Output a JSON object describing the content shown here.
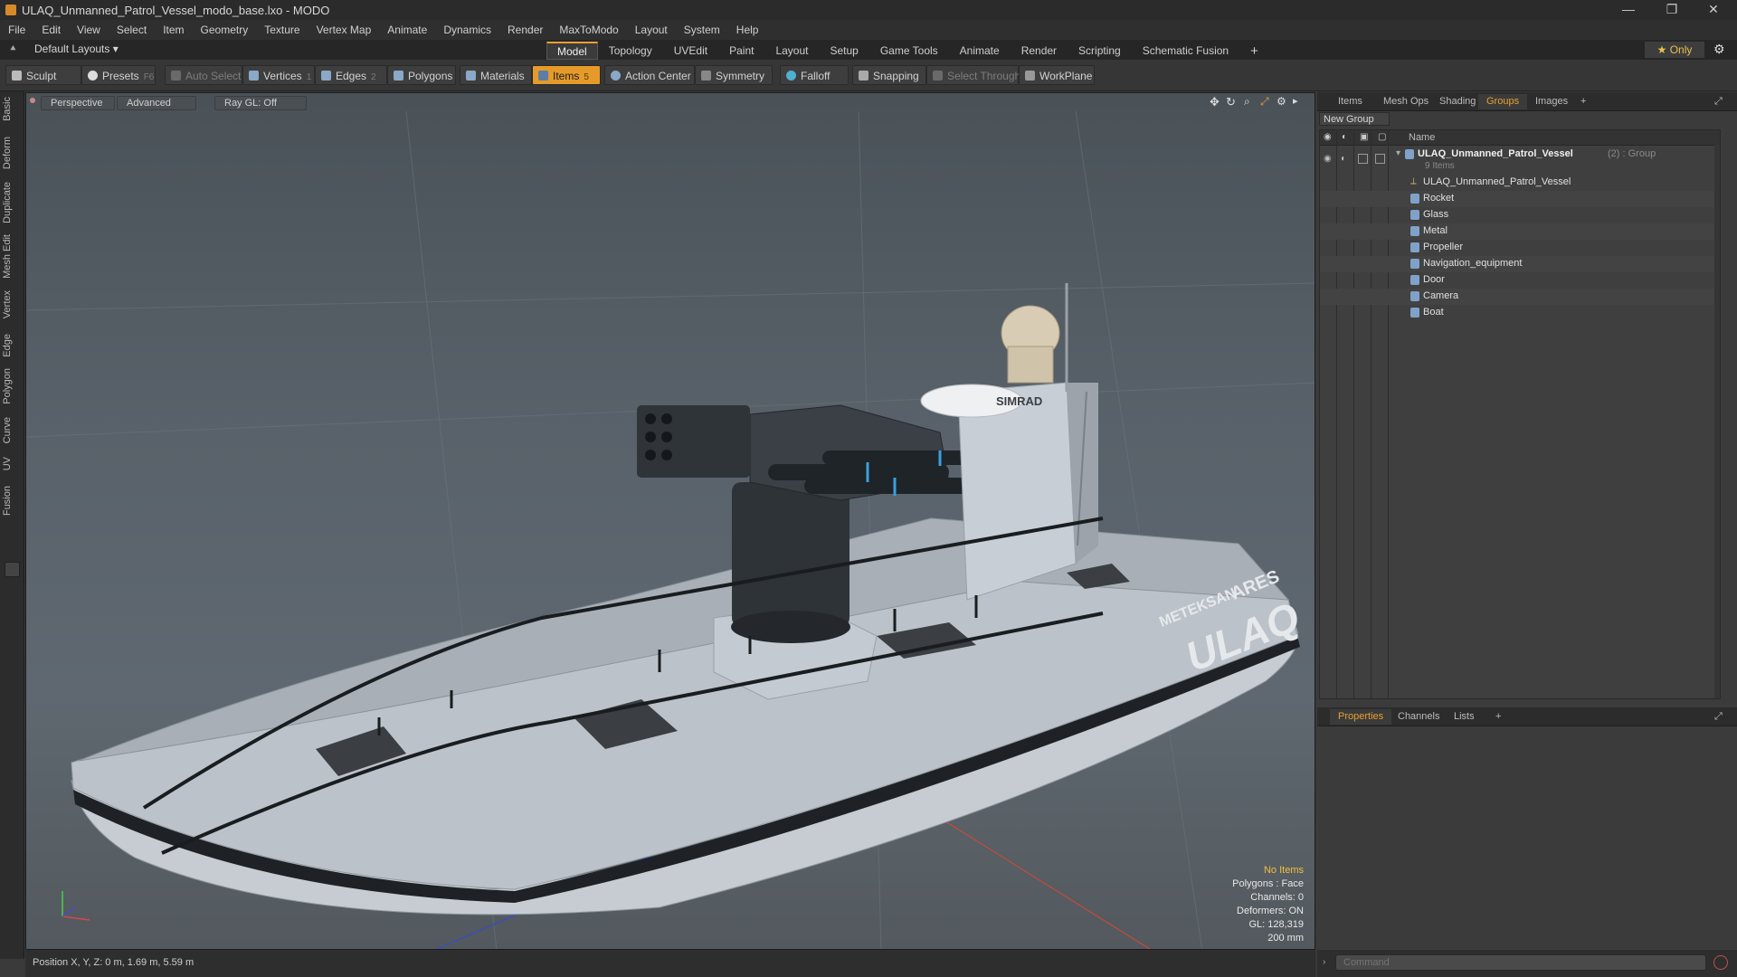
{
  "window": {
    "title": "ULAQ_Unmanned_Patrol_Vessel_modo_base.lxo - MODO",
    "minimize": "—",
    "restore": "❐",
    "close": "✕"
  },
  "menu": [
    "File",
    "Edit",
    "View",
    "Select",
    "Item",
    "Geometry",
    "Texture",
    "Vertex Map",
    "Animate",
    "Dynamics",
    "Render",
    "MaxToModo",
    "Layout",
    "System",
    "Help"
  ],
  "layout_selector": "Default Layouts ▾",
  "tabs": [
    "Model",
    "Topology",
    "UVEdit",
    "Paint",
    "Layout",
    "Setup",
    "Game Tools",
    "Animate",
    "Render",
    "Scripting",
    "Schematic Fusion"
  ],
  "active_tab": "Model",
  "only_button": "★ Only",
  "toolbar": {
    "sculpt": "Sculpt",
    "presets": "Presets",
    "presets_key": "F6",
    "auto_select": "Auto Select",
    "vertices": "Vertices",
    "vertices_key": "1",
    "edges": "Edges",
    "edges_key": "2",
    "polygons": "Polygons",
    "materials": "Materials",
    "items": "Items",
    "items_key": "5",
    "action_center": "Action Center",
    "symmetry": "Symmetry",
    "falloff": "Falloff",
    "snapping": "Snapping",
    "select_through": "Select Through",
    "workplane": "WorkPlane"
  },
  "left_tabs": [
    "Basic",
    "Deform",
    "Duplicate",
    "Mesh Edit",
    "Vertex",
    "Edge",
    "Polygon",
    "Curve",
    "UV",
    "Fusion"
  ],
  "viewport": {
    "view": "Perspective",
    "shading": "Advanced",
    "raygl": "Ray GL: Off",
    "hud": {
      "no_items": "No Items",
      "polygons": "Polygons : Face",
      "channels": "Channels: 0",
      "deformers": "Deformers: ON",
      "gl": "GL: 128,319",
      "scale": "200 mm"
    },
    "boat_text": {
      "brand": "ULAQ",
      "company1": "METEKSAN",
      "company2": "ARES",
      "radar": "SIMRAD"
    }
  },
  "status": {
    "position": "Position X, Y, Z:  0 m, 1.69 m, 5.59 m"
  },
  "right_panel": {
    "tabs": [
      "Items",
      "Mesh Ops",
      "Shading",
      "Groups",
      "Images"
    ],
    "active_tab": "Groups",
    "new_group": "New Group",
    "name_header": "Name",
    "group": {
      "name": "ULAQ_Unmanned_Patrol_Vessel",
      "suffix": "(2) : Group",
      "count": "9 Items"
    },
    "items": [
      "ULAQ_Unmanned_Patrol_Vessel",
      "Rocket",
      "Glass",
      "Metal",
      "Propeller",
      "Navigation_equipment",
      "Door",
      "Camera",
      "Boat"
    ],
    "bottom_tabs": [
      "Properties",
      "Channels",
      "Lists"
    ],
    "bottom_active": "Properties",
    "command_placeholder": "Command"
  },
  "colors": {
    "accent": "#e59a2a",
    "viewport_bg": "#59626a"
  }
}
